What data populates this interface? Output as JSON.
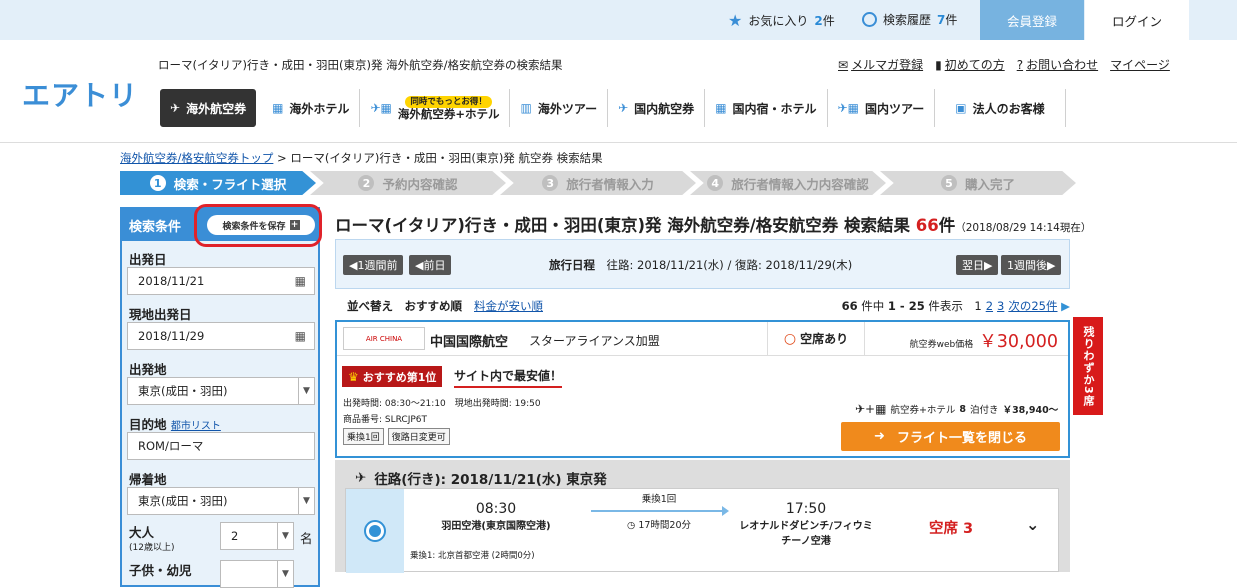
{
  "header": {
    "favorites_label": "お気に入り",
    "favorites_count": "2",
    "favorites_unit": "件",
    "history_label": "検索履歴",
    "history_count": "7",
    "history_unit": "件",
    "member_register": "会員登録",
    "login": "ログイン",
    "logo": "エアトリ",
    "tagline": "ローマ(イタリア)行き・成田・羽田(東京)発 海外航空券/格安航空券の検索結果",
    "links": [
      "メルマガ登録",
      "初めての方",
      "お問い合わせ",
      "マイページ"
    ]
  },
  "nav": {
    "items": [
      "海外航空券",
      "海外ホテル",
      "海外航空券+ホテル",
      "海外ツアー",
      "国内航空券",
      "国内宿・ホテル",
      "国内ツアー",
      "法人のお客様"
    ],
    "promo_pill": "同時でもっとお得！"
  },
  "breadcrumb": {
    "link": "海外航空券/格安航空券トップ",
    "sep": " > ",
    "current": "ローマ(イタリア)行き・成田・羽田(東京)発 航空券 検索結果"
  },
  "steps": [
    {
      "num": "1",
      "label": "検索・フライト選択"
    },
    {
      "num": "2",
      "label": "予約内容確認"
    },
    {
      "num": "3",
      "label": "旅行者情報入力"
    },
    {
      "num": "4",
      "label": "旅行者情報入力内容確認"
    },
    {
      "num": "5",
      "label": "購入完了"
    }
  ],
  "sidebar": {
    "title": "検索条件",
    "save_button": "検索条件を保存",
    "departure_date_label": "出発日",
    "departure_date": "2018/11/21",
    "local_departure_label": "現地出発日",
    "local_departure": "2018/11/29",
    "origin_label": "出発地",
    "origin": "東京(成田・羽田)",
    "destination_label": "目的地",
    "city_list_link": "都市リスト",
    "destination": "ROM/ローマ",
    "return_label": "帰着地",
    "return_value": "東京(成田・羽田)",
    "adults_label": "大人",
    "adults_sub": "(12歳以上)",
    "adults_value": "2",
    "adults_unit": "名",
    "children_label": "子供・幼児"
  },
  "results": {
    "title": "ローマ(イタリア)行き・成田・羽田(東京)発 海外航空券/格安航空券 検索結果 ",
    "count": "66",
    "count_unit": "件",
    "timestamp": "（2018/08/29 14:14現在）",
    "prev_week": "1週間前",
    "prev_day": "前日",
    "next_day": "翌日",
    "next_week": "1週間後",
    "schedule_label": "旅行日程",
    "schedule": "往路: 2018/11/21(水) / 復路: 2018/11/29(木)",
    "sort_label": "並べ替え",
    "sort_recommended": "おすすめ順",
    "sort_cheap": "料金が安い順",
    "page_info_count": "66",
    "page_info_text": "件中",
    "page_range": "1 - 25",
    "page_info_tail": "件表示",
    "pages": [
      "1",
      "2",
      "3"
    ],
    "next_25": "次の25件"
  },
  "card": {
    "airline_logo": "AIR CHINA",
    "airline": "中国国際航空",
    "alliance": "スターアライアンス加盟",
    "seat_status": "空席あり",
    "price_label": "航空券web価格",
    "price": "￥30,000",
    "rank_badge": "おすすめ第1位",
    "cheapest": "サイト内で最安値！",
    "times": "出発時間: 08:30〜21:10　現地出発時間: 19:50",
    "product_code": "商品番号: SLRCJP6T",
    "tags": [
      "乗換1回",
      "復路日変更可"
    ],
    "hotel_label": "航空券+ホテル",
    "hotel_nights": "8",
    "hotel_nights_unit": "泊付き",
    "hotel_price": "￥38,940〜",
    "close_button": "フライト一覧を閉じる",
    "few_seats": "残りわずか3席"
  },
  "outbound": {
    "title": "往路(行き): 2018/11/21(水) 東京発",
    "dep_time": "08:30",
    "dep_airport": "羽田空港(東京国際空港)",
    "transfers": "乗換1回",
    "duration": "17時間20分",
    "arr_time": "17:50",
    "arr_airport": "レオナルドダビンチ/フィウミチーノ空港",
    "seats": "空席 3",
    "transit": "乗換1: 北京首都空港 (2時間0分)"
  }
}
